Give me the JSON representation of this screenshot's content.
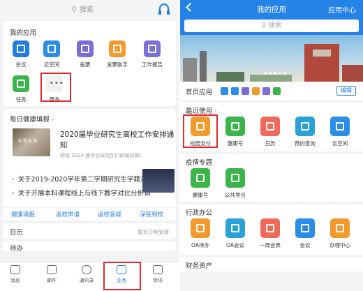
{
  "left": {
    "search_placeholder": "搜索",
    "my_apps": {
      "title": "我的应用",
      "items": [
        {
          "label": "会议",
          "icon": "video-camera-icon",
          "color": "#1f7ee0"
        },
        {
          "label": "云空间",
          "icon": "cube-icon",
          "color": "#2a8de8"
        },
        {
          "label": "投票",
          "icon": "vote-icon",
          "color": "#7c6ad6"
        },
        {
          "label": "发票助手",
          "icon": "invoice-icon",
          "color": "#f29a2e"
        },
        {
          "label": "工作报告",
          "icon": "report-icon",
          "color": "#7b6fd8"
        },
        {
          "label": "任务",
          "icon": "shield-check-icon",
          "color": "#3bb54a"
        }
      ],
      "more_label": "更多",
      "more_glyph": "•••"
    },
    "health": {
      "title": "每日健康填报",
      "chevron": "›",
      "headline": "2020届毕业研究生离校工作安排通知",
      "subline": "预祝 2020 届毕业研究生们前程似锦！",
      "thumb_text": "前程似锦",
      "bullets": [
        "关于2019-2020学年第二学期研究生学籍注册...",
        "关于开展本科课程线上与线下教学对比分析调..."
      ],
      "links": [
        "健康填报",
        "返校申请",
        "返校答疑",
        "深夜到校"
      ]
    },
    "calendar": {
      "title": "日历",
      "status": "暂无日程安排"
    },
    "todo": {
      "title": "待办"
    },
    "nav": [
      {
        "label": "消息",
        "icon": "message-icon"
      },
      {
        "label": "邮件",
        "icon": "mail-icon"
      },
      {
        "label": "通讯录",
        "icon": "contacts-icon"
      },
      {
        "label": "业务",
        "icon": "business-icon",
        "active": true
      },
      {
        "label": "资讯",
        "icon": "news-icon"
      }
    ]
  },
  "right": {
    "title": "我的应用",
    "center_label": "应用中心",
    "search_placeholder": "搜索",
    "home_apps_label": "首页应用",
    "home_mini_colors": [
      "#2a8de8",
      "#2a8de8",
      "#7c6ad6",
      "#f29a2e",
      "#7b6fd8",
      "#3bb54a"
    ],
    "edit_label": "编辑",
    "sections": [
      {
        "title": "最近使用",
        "chevron": "›",
        "items": [
          {
            "label": "校园支付",
            "icon": "wallet-icon",
            "color": "#f29a2e"
          },
          {
            "label": "健康号",
            "icon": "leaf-icon",
            "color": "#3bb54a"
          },
          {
            "label": "日历",
            "icon": "calendar-icon",
            "color": "#f06a5c"
          },
          {
            "label": "预约查询",
            "icon": "search-doc-icon",
            "color": "#2aa2d8"
          },
          {
            "label": "云空间",
            "icon": "cube-icon",
            "color": "#2a8de8"
          }
        ]
      },
      {
        "title": "疫情专题",
        "items": [
          {
            "label": "健康号",
            "icon": "leaf-icon",
            "color": "#3bb54a"
          },
          {
            "label": "公共导引",
            "icon": "guide-icon",
            "color": "#3bb54a"
          }
        ]
      },
      {
        "title": "行政办公",
        "items": [
          {
            "label": "OA待办",
            "icon": "user-task-icon",
            "color": "#f29a2e"
          },
          {
            "label": "OA会议",
            "icon": "grid-icon",
            "color": "#2aa2d8"
          },
          {
            "label": "一周会表",
            "icon": "building-icon",
            "color": "#f06a5c"
          },
          {
            "label": "会议",
            "icon": "video-camera-icon",
            "color": "#2a8de8"
          },
          {
            "label": "办理中心",
            "icon": "briefcase-icon",
            "color": "#f29a2e"
          }
        ]
      },
      {
        "title": "财务资产"
      }
    ]
  }
}
